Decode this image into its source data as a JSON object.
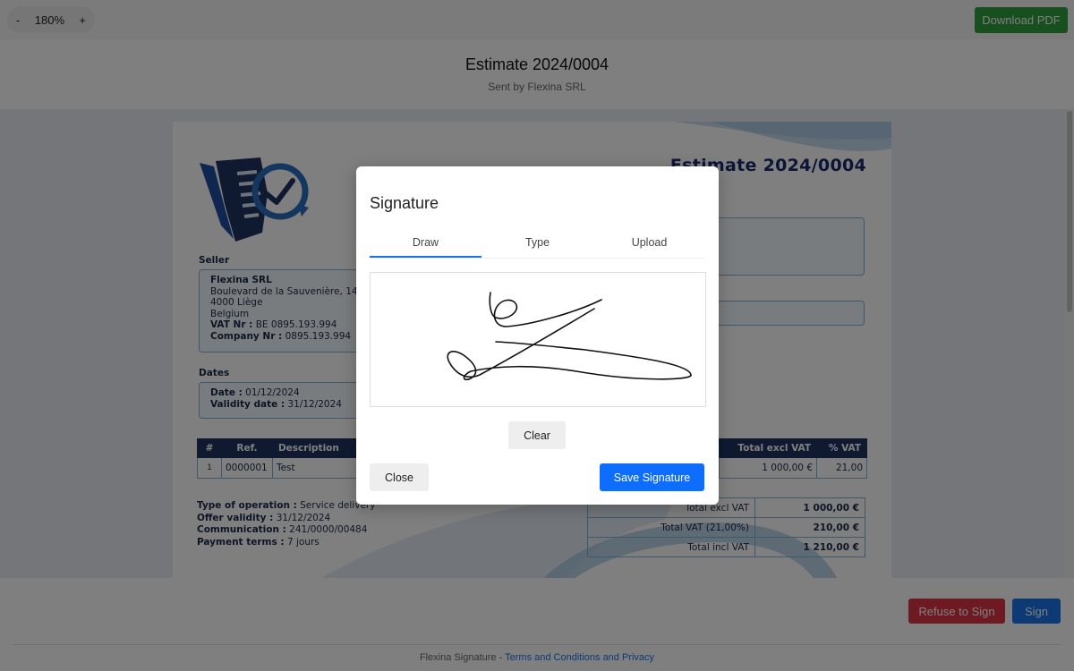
{
  "toolbar": {
    "zoom_out": "-",
    "zoom_level": "180%",
    "zoom_in": "+",
    "download_label": "Download PDF"
  },
  "header": {
    "title": "Estimate 2024/0004",
    "subtitle": "Sent by Flexina SRL"
  },
  "document": {
    "title": "Estimate 2024/0004",
    "seller_label": "Seller",
    "seller": {
      "name": "Flexina SRL",
      "street": "Boulevard de la Sauvenière, 14",
      "city": "4000 Liège",
      "country": "Belgium",
      "vat_label": "VAT Nr :",
      "vat_value": "BE 0895.193.994",
      "company_label": "Company Nr :",
      "company_value": "0895.193.994"
    },
    "dates_label": "Dates",
    "dates": {
      "date_label": "Date :",
      "date_value": "01/12/2024",
      "validity_label": "Validity date :",
      "validity_value": "31/12/2024"
    },
    "table": {
      "headers": [
        "#",
        "Ref.",
        "Description",
        "Total excl VAT",
        "% VAT"
      ],
      "rows": [
        {
          "num": "1",
          "ref": "0000001",
          "description": "Test",
          "total": "1 000,00 €",
          "vat": "21,00"
        }
      ]
    },
    "terms": {
      "operation_label": "Type of operation :",
      "operation_value": "Service delivery",
      "validity_label": "Offer validity :",
      "validity_value": "31/12/2024",
      "communication_label": "Communication :",
      "communication_value": "241/0000/00484",
      "payment_label": "Payment terms :",
      "payment_value": "7 jours"
    },
    "totals": [
      {
        "label": "Total excl VAT",
        "value": "1 000,00 €"
      },
      {
        "label": "Total VAT (21,00%)",
        "value": "210,00 €"
      },
      {
        "label": "Total incl VAT",
        "value": "1 210,00 €"
      }
    ]
  },
  "footer": {
    "refuse_label": "Refuse to Sign",
    "sign_label": "Sign",
    "brand": "Flexina Signature -",
    "terms_link": "Terms and Conditions and Privacy"
  },
  "modal": {
    "title": "Signature",
    "tabs": [
      "Draw",
      "Type",
      "Upload"
    ],
    "active_tab": "Draw",
    "clear_label": "Clear",
    "close_label": "Close",
    "save_label": "Save Signature"
  },
  "colors": {
    "download": "#2e9e3c",
    "refuse": "#dc3545",
    "sign": "#1a73e8",
    "save": "#0d6efd",
    "doc_navy": "#1f3563",
    "doc_accent": "#7fb2d8"
  }
}
